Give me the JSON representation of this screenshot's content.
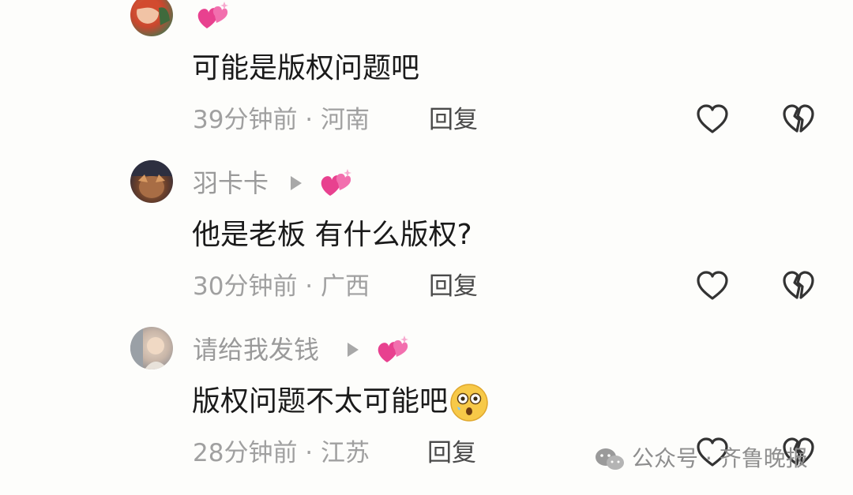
{
  "comments": [
    {
      "username": "",
      "text": "可能是版权问题吧",
      "meta": "39分钟前 · 河南",
      "reply_label": "回复"
    },
    {
      "username": "羽卡卡",
      "text": "他是老板 有什么版权?",
      "meta": "30分钟前 · 广西",
      "reply_label": "回复"
    },
    {
      "username": "请给我发钱",
      "text": "版权问题不太可能吧",
      "meta": "28分钟前 · 江苏",
      "reply_label": "回复"
    }
  ],
  "watermark": {
    "text": "公众号 · 齐鲁晚报",
    "icon": "wechat-icon"
  },
  "colors": {
    "sticker_pink": "#e8418f",
    "icon_stroke": "#333333"
  }
}
